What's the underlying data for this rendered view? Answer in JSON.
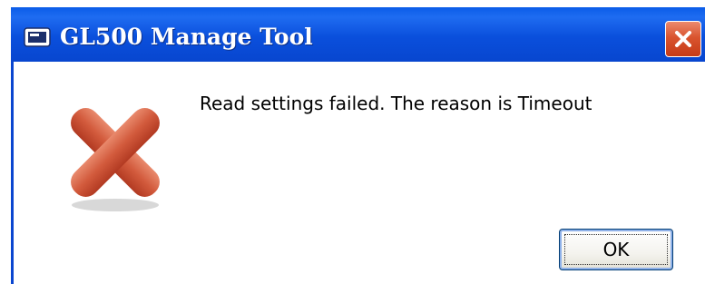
{
  "window": {
    "title": "GL500 Manage Tool"
  },
  "dialog": {
    "message": "Read settings failed. The reason is Timeout",
    "ok_label": "OK"
  },
  "icons": {
    "app": "app-window-icon",
    "close": "close-icon",
    "error": "error-x-icon"
  },
  "colors": {
    "titlebar": "#0a4fdc",
    "close_button": "#d9542f",
    "error_icon": "#c84a32"
  }
}
